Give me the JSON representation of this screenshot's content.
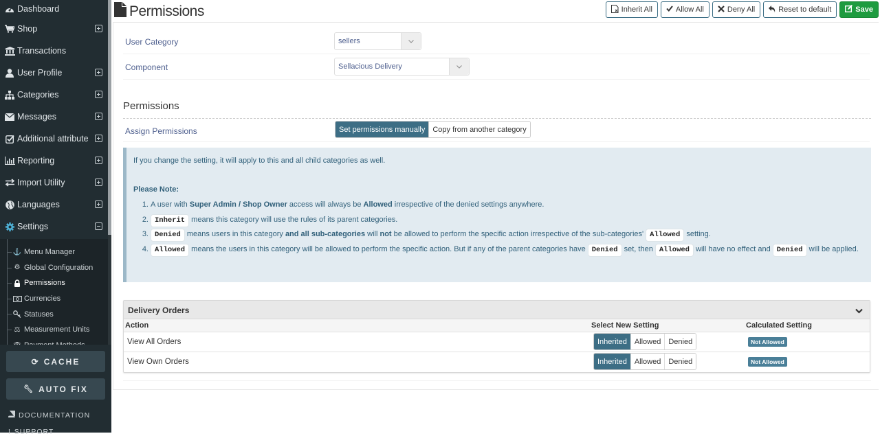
{
  "sidebar": {
    "menu": [
      {
        "label": "Dashboard",
        "icon": "dashboard-icon",
        "expander": "none"
      },
      {
        "label": "Shop",
        "icon": "cart-icon",
        "expander": "plus"
      },
      {
        "label": "Transactions",
        "icon": "bank-icon",
        "expander": "none"
      },
      {
        "label": "User Profile",
        "icon": "user-icon",
        "expander": "plus"
      },
      {
        "label": "Categories",
        "icon": "sitemap-icon",
        "expander": "plus"
      },
      {
        "label": "Messages",
        "icon": "envelope-icon",
        "expander": "plus"
      },
      {
        "label": "Additional attribute",
        "icon": "checkbox-icon",
        "expander": "plus"
      },
      {
        "label": "Reporting",
        "icon": "bar-chart-icon",
        "expander": "plus"
      },
      {
        "label": "Import Utility",
        "icon": "exchange-icon",
        "expander": "plus"
      },
      {
        "label": "Languages",
        "icon": "globe-icon",
        "expander": "plus"
      },
      {
        "label": "Settings",
        "icon": "gear-icon",
        "expander": "minus"
      }
    ],
    "submenu": [
      {
        "label": "Menu Manager",
        "icon": "anchor-icon",
        "active": false
      },
      {
        "label": "Global Configuration",
        "icon": "gears-icon",
        "active": false
      },
      {
        "label": "Permissions",
        "icon": "lock-icon",
        "active": true
      },
      {
        "label": "Currencies",
        "icon": "money-icon",
        "active": false
      },
      {
        "label": "Statuses",
        "icon": "key-icon",
        "active": false
      },
      {
        "label": "Measurement Units",
        "icon": "balance-scale-icon",
        "active": false
      },
      {
        "label": "Payment Methods",
        "icon": "bank-icon",
        "active": false
      }
    ],
    "cache_label": "CACHE",
    "autofix_label": "AUTO FIX",
    "documentation_label": "DOCUMENTATION",
    "support_label": "SUPPORT"
  },
  "header": {
    "title": "Permissions",
    "buttons": {
      "inherit_all": "Inherit All",
      "allow_all": "Allow All",
      "deny_all": "Deny All",
      "reset": "Reset to default",
      "save": "Save"
    }
  },
  "form": {
    "user_category_label": "User Category",
    "user_category_value": "sellers",
    "component_label": "Component",
    "component_value": "Sellacious Delivery",
    "section_title": "Permissions",
    "assign_label": "Assign Permissions",
    "assign_options": [
      "Set permissions manually",
      "Copy from another category"
    ],
    "assign_selected": "Set permissions manually"
  },
  "note": {
    "intro": "If you change the setting, it will apply to this and all child categories as well.",
    "heading": "Please Note:",
    "item1": {
      "n": "1.",
      "a": "A user with ",
      "b1": "Super Admin / Shop Owner",
      "c": " access will always be ",
      "b2": "Allowed",
      "d": " irrespective of the denied settings anywhere."
    },
    "item2": {
      "n": "2.",
      "code": "Inherit",
      "text": " means this category will use the rules of its parent categories."
    },
    "item3": {
      "n": "3.",
      "code": "Denied",
      "a": " means users in this category ",
      "b1": "and all sub-categories",
      "c": " will ",
      "b2": "not",
      "d": " be allowed to perform the specific action irrespective of the sub-categories' ",
      "code2": "Allowed",
      "e": " setting."
    },
    "item4": {
      "n": "4.",
      "code": "Allowed",
      "a": " means the users in this category will be allowed to perform the specific action. But if any of the parent categories have ",
      "code2": "Denied",
      "b": " set, then ",
      "code3": "Allowed",
      "c": " will have no effect and ",
      "code4": "Denied",
      "d": " will be applied."
    }
  },
  "permissions_group": {
    "title": "Delivery Orders",
    "columns": [
      "Action",
      "Select New Setting",
      "Calculated Setting"
    ],
    "options": [
      "Inherited",
      "Allowed",
      "Denied"
    ],
    "rows": [
      {
        "action": "View All Orders",
        "selected": "Inherited",
        "calculated": "Not Allowed"
      },
      {
        "action": "View Own Orders",
        "selected": "Inherited",
        "calculated": "Not Allowed"
      }
    ]
  }
}
